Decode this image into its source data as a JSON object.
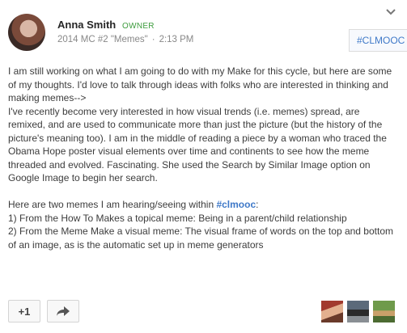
{
  "post": {
    "author": "Anna Smith",
    "role_badge": "OWNER",
    "community": "2014 MC #2 \"Memes\"",
    "separator": "·",
    "time": "2:13 PM",
    "hashtag_chip": "#CLMOOC",
    "paragraph1": "I am still working on what I am going to do with my Make for this cycle, but here are some of my thoughts. I'd love to talk through ideas with folks who are interested in thinking and making memes-->",
    "paragraph2": "I've recently become very interested in how visual trends (i.e. memes) spread, are remixed, and are used to communicate more than just the picture (but the history of the picture's meaning too). I am in the middle of reading a piece by a woman who traced the Obama Hope poster visual elements over time and continents to see how the meme threaded and evolved. Fascinating. She used the Search by Similar Image option on Google Image to begin her search.",
    "paragraph3_prefix": "Here are two memes I am hearing/seeing within ",
    "paragraph3_tag": "#clmooc",
    "paragraph3_suffix": ":",
    "list_item1": "1) From the How To Makes a topical meme: Being in a parent/child relationship",
    "list_item2": "2) From the Meme Make a visual meme: The visual frame of words on the top and bottom of an image, as is the automatic set up in meme generators"
  },
  "actions": {
    "plus_one_label": "+1",
    "share_icon": "share-arrow-icon",
    "menu_icon": "chevron-down-icon"
  },
  "colors": {
    "link": "#3f79c8",
    "owner": "#3d9c3d",
    "meta": "#888888"
  }
}
